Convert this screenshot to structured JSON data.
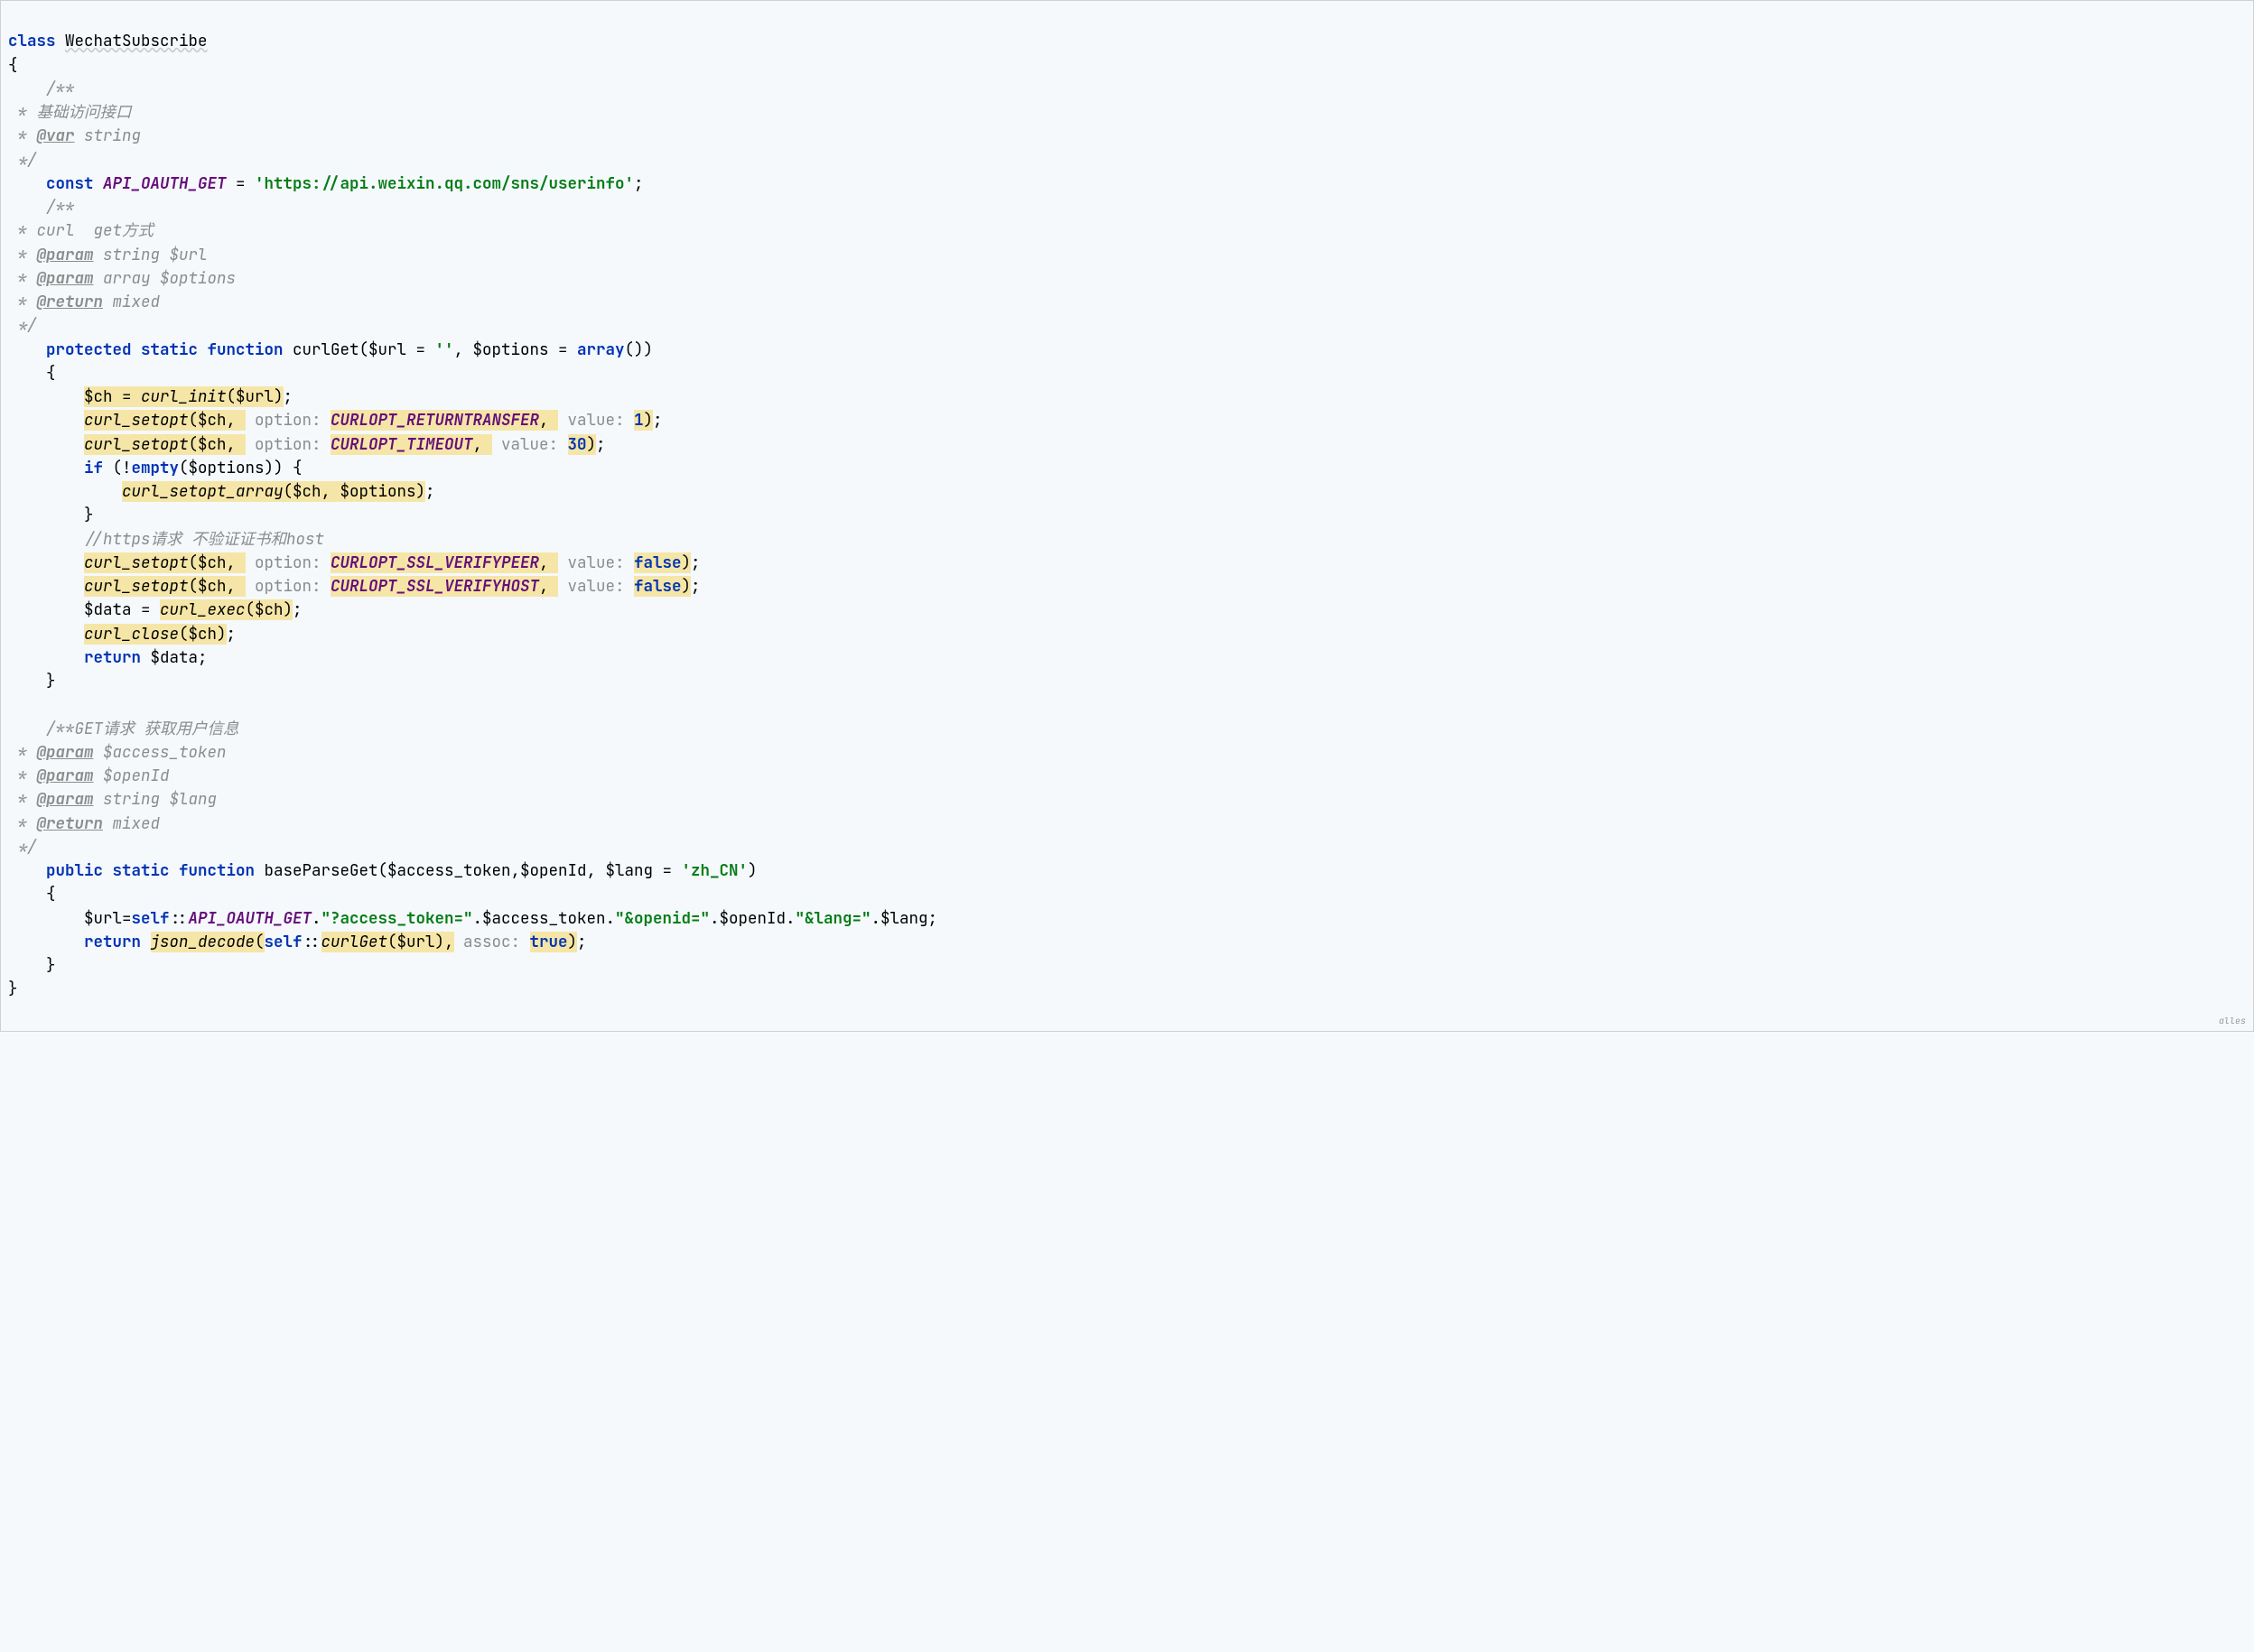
{
  "kw": {
    "class": "class",
    "const": "const",
    "protected": "protected",
    "static": "static",
    "function": "function",
    "if": "if",
    "return": "return",
    "public": "public",
    "array": "array",
    "empty": "empty",
    "self": "self",
    "true": "true",
    "false": "false"
  },
  "className": "WechatSubscribe",
  "doc1": {
    "line1": " * 基础访问接口",
    "varTag": "@var",
    "varType": " string"
  },
  "constName": "API_OAUTH_GET",
  "constValue": "'https://api.weixin.qq.com/sns/userinfo'",
  "doc2": {
    "line1": " * curl  get方式",
    "paramTag": "@param",
    "param1": " string $url",
    "param2": " array $options",
    "returnTag": "@return",
    "returnType": " mixed"
  },
  "curlGet": {
    "name": "curlGet",
    "p1": "$url",
    "p1def": "''",
    "p2": "$options",
    "ch": "$ch",
    "curl_init": "curl_init",
    "curl_setopt": "curl_setopt",
    "curl_setopt_array": "curl_setopt_array",
    "curl_exec": "curl_exec",
    "curl_close": "curl_close",
    "optionHint": "option: ",
    "valueHint": "value: ",
    "RETURNTRANSFER": "CURLOPT_RETURNTRANSFER",
    "TIMEOUT": "CURLOPT_TIMEOUT",
    "SSLVP": "CURLOPT_SSL_VERIFYPEER",
    "SSLVH": "CURLOPT_SSL_VERIFYHOST",
    "v1": "1",
    "v30": "30",
    "httpsComment": "//https请求 不验证证书和host",
    "data": "$data"
  },
  "doc3": {
    "line1": "/**GET请求 获取用户信息",
    "paramTag": "@param",
    "p1": " $access_token",
    "p2": " $openId",
    "p3": " string $lang",
    "returnTag": "@return",
    "returnType": " mixed"
  },
  "baseParseGet": {
    "name": "baseParseGet",
    "p1": "$access_token",
    "p2": "$openId",
    "p3": "$lang",
    "p3def": "'zh_CN'",
    "url": "$url",
    "q1": "\"?access_token=\"",
    "q2": "\"&openid=\"",
    "q3": "\"&lang=\"",
    "json_decode": "json_decode",
    "curlGet": "curlGet",
    "assocHint": "assoc: "
  },
  "watermark": "alles"
}
